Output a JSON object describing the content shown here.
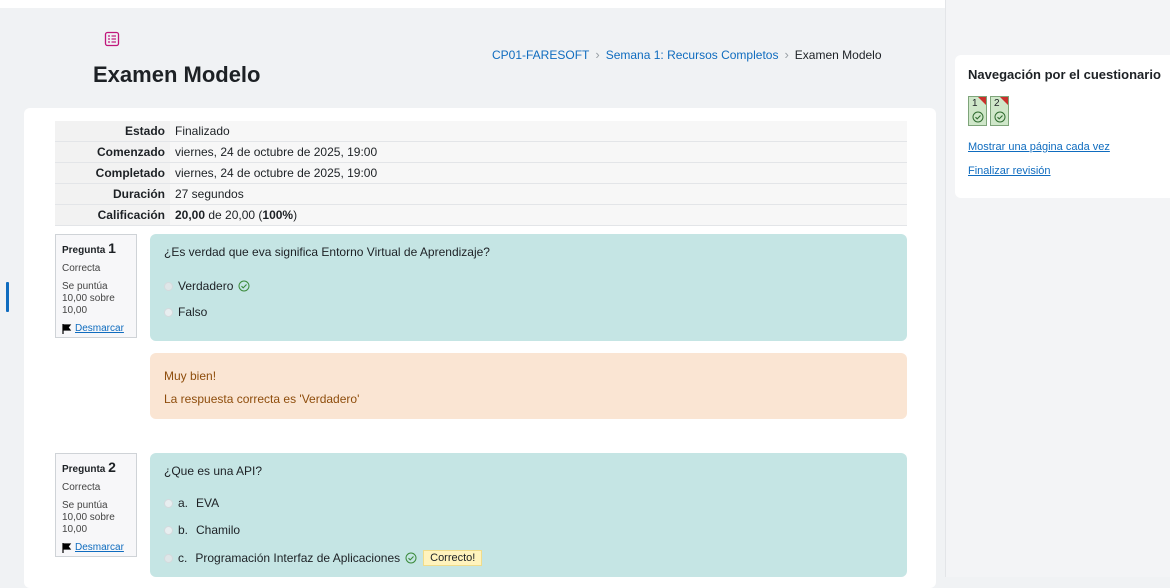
{
  "header": {
    "title": "Examen Modelo",
    "breadcrumb": [
      "CP01-FARESOFT",
      "Semana 1: Recursos Completos",
      "Examen Modelo"
    ]
  },
  "summary": [
    {
      "label": "Estado",
      "value": "Finalizado"
    },
    {
      "label": "Comenzado",
      "value": "viernes, 24 de octubre de 2025, 19:00"
    },
    {
      "label": "Completado",
      "value": "viernes, 24 de octubre de 2025, 19:00"
    },
    {
      "label": "Duración",
      "value": "27 segundos"
    },
    {
      "label": "Calificación",
      "value_bold": "20,00",
      "value_mid": " de 20,00 (",
      "value_pct": "100%",
      "value_end": ")"
    }
  ],
  "questions": [
    {
      "prefix": "Pregunta",
      "number": "1",
      "state": "Correcta",
      "grade": "Se puntúa 10,00 sobre 10,00",
      "flag": "Desmarcar",
      "text": "¿Es verdad que eva significa Entorno Virtual de Aprendizaje?",
      "answers": [
        {
          "text": "Verdadero"
        },
        {
          "text": "Falso"
        }
      ],
      "feedback": {
        "general": "Muy bien!",
        "right": "La respuesta correcta es 'Verdadero'"
      }
    },
    {
      "prefix": "Pregunta",
      "number": "2",
      "state": "Correcta",
      "grade": "Se puntúa 10,00 sobre 10,00",
      "flag": "Desmarcar",
      "text": "¿Que es una API?",
      "answers": [
        {
          "label": "a.",
          "text": "EVA"
        },
        {
          "label": "b.",
          "text": "Chamilo"
        },
        {
          "label": "c.",
          "text": "Programación Interfaz de Aplicaciones",
          "badge": "Correcto!"
        }
      ]
    }
  ],
  "nav": {
    "title": "Navegación por el cuestionario",
    "buttons": [
      "1",
      "2"
    ],
    "links": [
      "Mostrar una página cada vez",
      "Finalizar revisión"
    ]
  },
  "colors": {
    "link": "#0f6cbf",
    "correct_bg": "#c5e5e4",
    "feedback_bg": "#fae5d3",
    "flag": "#c9302c"
  },
  "icons": [
    "quiz-icon",
    "chevron-right-icon",
    "check-circle-icon",
    "flag-icon"
  ]
}
